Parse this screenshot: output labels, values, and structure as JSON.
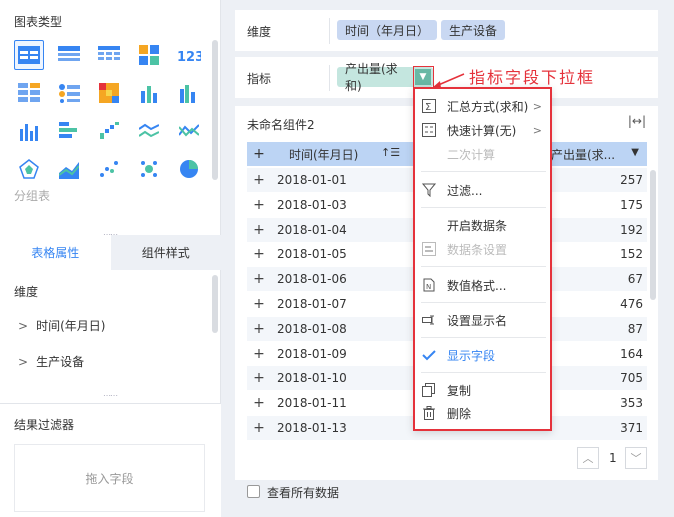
{
  "left": {
    "chart_type_title": "图表类型",
    "group_label": "分组表",
    "tabs": [
      {
        "label": "表格属性"
      },
      {
        "label": "组件样式"
      }
    ],
    "dimension_title": "维度",
    "dimension_items": [
      {
        "label": "时间(年月日)"
      },
      {
        "label": "生产设备"
      }
    ],
    "filter_title": "结果过滤器",
    "drop_hint": "拖入字段"
  },
  "top": {
    "dimension_label": "维度",
    "dimension_pills": [
      "时间（年月日）",
      "生产设备"
    ],
    "indicator_label": "指标",
    "indicator_pill": "产出量(求和)",
    "annotation": "指标字段下拉框"
  },
  "table": {
    "widget_title": "未命名组件2",
    "col_date": "时间(年月日)",
    "col_value": "产出量(求...",
    "rows": [
      {
        "date": "2018-01-01",
        "value": "257"
      },
      {
        "date": "2018-01-03",
        "value": "175"
      },
      {
        "date": "2018-01-04",
        "value": "192"
      },
      {
        "date": "2018-01-05",
        "value": "152"
      },
      {
        "date": "2018-01-06",
        "value": "67"
      },
      {
        "date": "2018-01-07",
        "value": "476"
      },
      {
        "date": "2018-01-08",
        "value": "87"
      },
      {
        "date": "2018-01-09",
        "value": "164"
      },
      {
        "date": "2018-01-10",
        "value": "705"
      },
      {
        "date": "2018-01-11",
        "value": "353"
      },
      {
        "date": "2018-01-13",
        "value": "371"
      }
    ],
    "page": "1",
    "view_all": "查看所有数据"
  },
  "menu": {
    "items": [
      {
        "label": "汇总方式(求和)"
      },
      {
        "label": "快速计算(无)"
      },
      {
        "label": "二次计算"
      },
      {
        "label": "过滤..."
      },
      {
        "label": "开启数据条"
      },
      {
        "label": "数据条设置"
      },
      {
        "label": "数值格式..."
      },
      {
        "label": "设置显示名"
      },
      {
        "label": "显示字段"
      },
      {
        "label": "复制"
      },
      {
        "label": "删除"
      }
    ]
  },
  "colors": {
    "accent": "#3685f2",
    "annotation_red": "#e5323b",
    "header_blue": "#bcd4f4",
    "pill_blue": "#c9d8f2",
    "pill_green": "#c4e6df"
  }
}
